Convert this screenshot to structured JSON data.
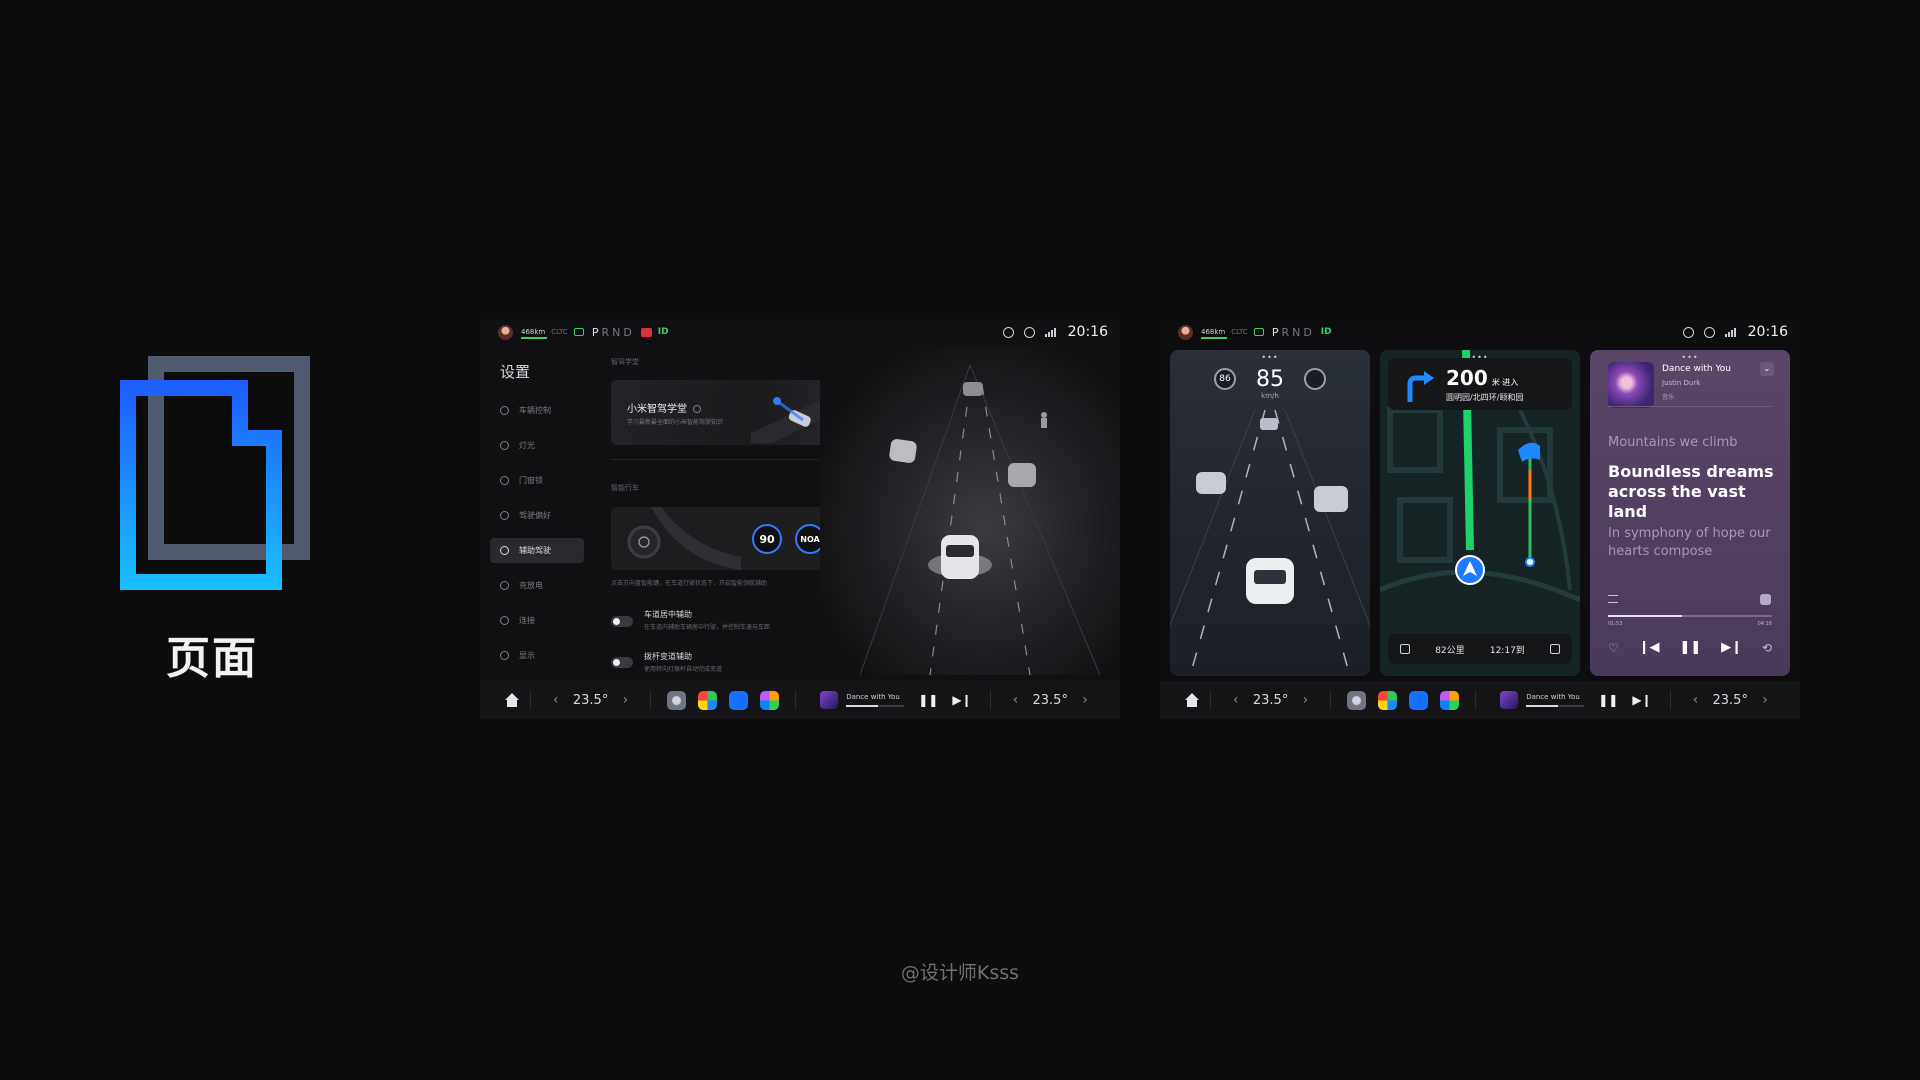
{
  "brand": {
    "label": "页面",
    "colors": {
      "blue": "#1e6bff",
      "cyan": "#1ab8ff",
      "back": "#505a6e"
    }
  },
  "watermark": "@设计师Ksss",
  "status": {
    "range": "468km",
    "cltc": "CLTC",
    "gear_p": "P",
    "gear_rest": "RND",
    "id": "ID",
    "time": "20:16"
  },
  "settings": {
    "title": "设置",
    "menu": [
      {
        "label": "车辆控制",
        "icon": "car-control-icon"
      },
      {
        "label": "灯光",
        "icon": "light-icon"
      },
      {
        "label": "门窗锁",
        "icon": "lock-icon"
      },
      {
        "label": "驾驶偏好",
        "icon": "wheel-icon"
      },
      {
        "label": "辅助驾驶",
        "icon": "assist-icon",
        "active": true
      },
      {
        "label": "充放电",
        "icon": "charge-icon"
      },
      {
        "label": "连接",
        "icon": "link-icon"
      },
      {
        "label": "显示",
        "icon": "display-icon"
      }
    ],
    "section1": "智驾学堂",
    "card1_title": "小米智驾学堂",
    "card1_sub": "学习最新最全面的小米智能驾驶知识",
    "section2": "智能行车",
    "speed_ring": "90",
    "noa_ring": "NOA",
    "note": "点击方向盘智能键，在车道行驶状态下，开启智能领航辅助",
    "toggle1_title": "车道居中辅助",
    "toggle1_sub": "在车道内辅助车辆居中行驶，并控制车速与车距",
    "toggle1_on": false,
    "toggle2_title": "拨杆变道辅助",
    "toggle2_sub": "使用转向灯拨杆自动完成变道",
    "toggle2_on": false
  },
  "dock": {
    "temp_left": "23.5°",
    "temp_right": "23.5°",
    "media_title": "Dance with You",
    "media_progress": 0.55,
    "apps": [
      "settings-app-icon",
      "map-app-icon",
      "video-call-app-icon",
      "app-grid-icon"
    ]
  },
  "drive": {
    "speed": "85",
    "unit": "km/h",
    "limit": "86"
  },
  "nav": {
    "distance": "200",
    "distance_unit": "米 进入",
    "road": "圆明园/北四环/颐和园",
    "remaining": "82公里",
    "eta": "12:17到"
  },
  "music": {
    "title": "Dance with You",
    "artist": "Justin Durk",
    "sub": "音乐",
    "lyric_prev": "Mountains we climb",
    "lyric_cur": "Boundless dreams across the vast land",
    "lyric_next": "In symphony of hope our hearts compose",
    "time_elapsed": "01:53",
    "time_total": "04:16",
    "progress": 0.45
  }
}
